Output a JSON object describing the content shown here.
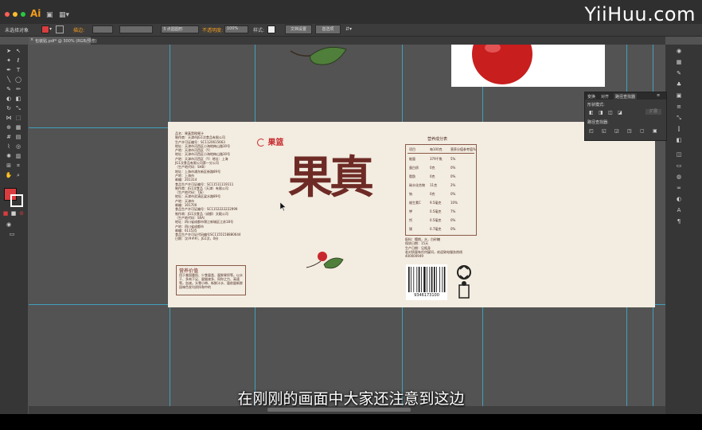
{
  "watermark": "YiiHuu.com",
  "app": {
    "logo": "Ai"
  },
  "control_bar": {
    "selection": "未选择对象",
    "stroke_label": "描边:",
    "brush": "3 点圆圆形",
    "opacity_label": "不透明度:",
    "opacity_value": "100%",
    "style_label": "样式:",
    "doc_settings": "文档设置",
    "preferences": "首选项"
  },
  "document_tab": {
    "label": "包装贴.pdf* @ 300% (RGB/预览)"
  },
  "panel": {
    "tabs": [
      "变换",
      "对齐",
      "路径查找器"
    ],
    "shape_modes": "形状模式:",
    "expand": "扩展",
    "pathfinder": "路径查找器:"
  },
  "artboard": {
    "brand_logo": "果篮",
    "title": "果真",
    "left_info": [
      "品名：果真是橙果汁",
      "制作商：天津市JG1汶食品有限公司",
      "生产许可证编号：SC1120615663",
      "地址：天津市河西区小海地梅山路30号",
      "产地：天津市河西区（Y）",
      "地址：天津市河西区小海地梅山路30号",
      "产地：天津市河西区（Y）地址：上海",
      "JG1汶食品有限公司第一分公司",
      "（生产地代码：SHB）",
      "地址：上海市浦东新区新路89号",
      "产地：上海市",
      "邮编：201314",
      "食品生产许可证编号：SC11511119111",
      "制作商：JG1汶食品（天津）有限公司",
      "（生产地代码：TJE）",
      "地址：天津市武清区梁水路89号",
      "产地：天津市",
      "邮编：301700",
      "食品生产许可证编号：SC1152222222999",
      "制作商：JG1汶食品（成都）文殿公司",
      "（生产地代码：SRA）",
      "地址：四川省成都市锦江新城区江苏18号",
      "产地：四川省成都市",
      "邮编：611535",
      "食品生产许可证代码编号SC1155158880644",
      "日期：汶/###/，JG1汶，0份"
    ],
    "notice_title": "营养价值",
    "notice_text": "用于美国重阳、少食量类、蛋鲜果积等。以水干、多肉下足、量猫液多、同你之力、高速等。血液。头零小带、新鲜汁水、量前量新鲜园味色发均质拌和中的",
    "nutrition": {
      "title": "营养成分表",
      "headers": [
        "项目",
        "每100克",
        "营养分值参考值%"
      ],
      "rows": [
        [
          "能量",
          "379千焦",
          "5%"
        ],
        [
          "蛋白质",
          "0克",
          "0%"
        ],
        [
          "脂肪",
          "0克",
          "0%"
        ],
        [
          "碳水化合物",
          "11克",
          "2%"
        ],
        [
          "钠",
          "0克",
          "0%"
        ],
        [
          "维生素C",
          "9.5毫克",
          "10%"
        ],
        [
          "钾",
          "0.5毫克",
          "7%"
        ],
        [
          "钙",
          "0.5毫克",
          "0%"
        ],
        [
          "镁",
          "0.7毫克",
          "0%"
        ]
      ]
    },
    "right_info": [
      "配料：樱桃，水，白砂糖",
      "保质日期：15天",
      "生产日期：见瓶身",
      "若对质量有任何疑问，欢迎致电服务热线",
      "400000949"
    ],
    "barcode_number": "9346173100"
  },
  "subtitle": "在刚刚的画面中大家还注意到这边",
  "colors": {
    "fill": "#d93d3f",
    "title": "#6e2b26",
    "guide": "#3fa9c8",
    "brand": "#c8282d"
  }
}
